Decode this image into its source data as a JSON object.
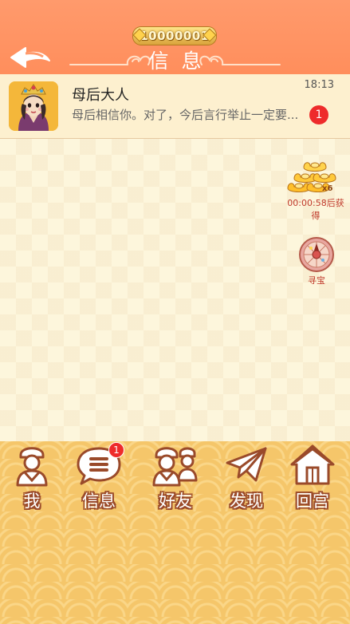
{
  "header": {
    "coins": "10000001",
    "title": "信息"
  },
  "conversation": {
    "name": "母后大人",
    "time": "18:13",
    "preview": "母后相信你。对了，今后言行举止一定要...",
    "unread": "1"
  },
  "reward": {
    "multiplier": "x6",
    "countdown": "00:00:58后获得"
  },
  "treasure": {
    "label": "寻宝"
  },
  "nav": {
    "items": [
      {
        "label": "我",
        "icon": "person-icon"
      },
      {
        "label": "信息",
        "icon": "message-icon",
        "badge": "1"
      },
      {
        "label": "好友",
        "icon": "friends-icon"
      },
      {
        "label": "发现",
        "icon": "paper-plane-icon"
      },
      {
        "label": "回宫",
        "icon": "home-icon"
      }
    ]
  },
  "colors": {
    "header": "#ff9a6c",
    "row_bg": "#fdf0cf",
    "badge": "#ee2b2b",
    "nav_bg": "#f5c66a",
    "nav_icon": "#9a4a2a"
  }
}
